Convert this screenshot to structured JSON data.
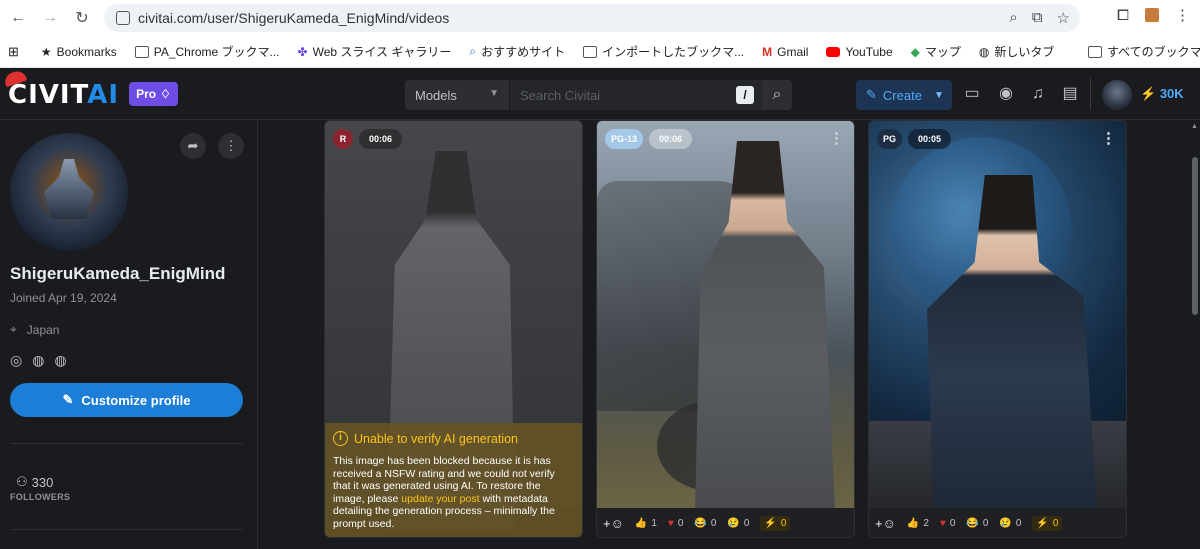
{
  "browser": {
    "url": "civitai.com/user/ShigeruKameda_EnigMind/videos",
    "bookmarks": [
      {
        "icon": "grid-icon",
        "label": ""
      },
      {
        "icon": "star-icon",
        "label": "Bookmarks"
      },
      {
        "icon": "folder-icon",
        "label": "PA_Chrome ブックマ..."
      },
      {
        "icon": "butterfly-icon",
        "label": "Web スライス ギャラリー"
      },
      {
        "icon": "search-icon",
        "label": "おすすめサイト"
      },
      {
        "icon": "folder-icon",
        "label": "インポートしたブックマ..."
      },
      {
        "icon": "gmail-icon",
        "label": "Gmail"
      },
      {
        "icon": "youtube-icon",
        "label": "YouTube"
      },
      {
        "icon": "maps-icon",
        "label": "マップ"
      },
      {
        "icon": "globe-icon",
        "label": "新しいタブ"
      }
    ],
    "all_bookmarks": "すべてのブックマーク"
  },
  "header": {
    "logo_main": "CIVIT",
    "logo_accent": "AI",
    "pro_label": "Pro",
    "search_category": "Models",
    "search_placeholder": "Search Civitai",
    "search_shortcut": "/",
    "create_label": "Create",
    "buzz_amount": "30K",
    "accent_color": "#228be6"
  },
  "profile": {
    "username": "ShigeruKameda_EnigMind",
    "joined": "Joined Apr 19, 2024",
    "location": "Japan",
    "customize_label": "Customize profile",
    "followers_count": "330",
    "followers_label": "FOLLOWERS"
  },
  "videos": [
    {
      "rating": "R",
      "rating_bg": "#8a2530",
      "rating_fg": "#ffffff",
      "duration": "00:06",
      "blocked": true,
      "warning_title": "Unable to verify AI generation",
      "warning_text_1": "This image has been blocked because it is has received a NSFW rating and we could not verify that it was generated using AI. To restore the image, please ",
      "warning_link": "update your post",
      "warning_text_2": " with metadata detailing the generation process – minimally the prompt used."
    },
    {
      "rating": "PG-13",
      "rating_bg": "#a5c8e8",
      "rating_fg": "#ffffff",
      "duration": "00:06",
      "blocked": false,
      "reactions": {
        "like": "1",
        "heart": "0",
        "laugh": "0",
        "cry": "0",
        "buzz": "0"
      }
    },
    {
      "rating": "PG",
      "rating_bg": "#1c2d44",
      "rating_fg": "#ffffff",
      "duration": "00:05",
      "blocked": false,
      "reactions": {
        "like": "2",
        "heart": "0",
        "laugh": "0",
        "cry": "0",
        "buzz": "0"
      }
    }
  ]
}
